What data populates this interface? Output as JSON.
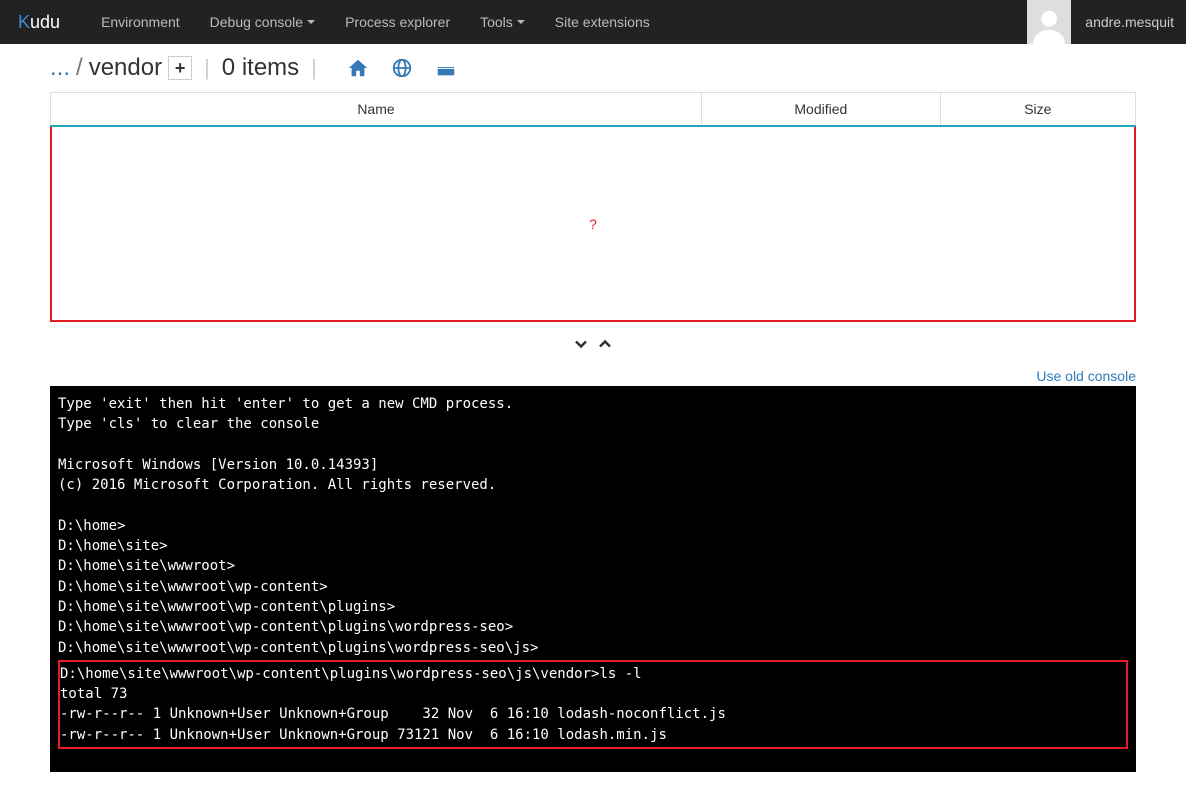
{
  "nav": {
    "brand_prefix": "K",
    "brand_rest": "udu",
    "items": [
      {
        "label": "Environment",
        "dropdown": false
      },
      {
        "label": "Debug console",
        "dropdown": true
      },
      {
        "label": "Process explorer",
        "dropdown": false
      },
      {
        "label": "Tools",
        "dropdown": true
      },
      {
        "label": "Site extensions",
        "dropdown": false
      }
    ],
    "username": "andre.mesquit"
  },
  "breadcrumb": {
    "ellipsis": "...",
    "current": "vendor",
    "item_count_label": "0 items"
  },
  "table": {
    "headers": {
      "name": "Name",
      "modified": "Modified",
      "size": "Size"
    }
  },
  "dropzone": {
    "placeholder": "?"
  },
  "console_link": "Use old console",
  "console": {
    "intro": [
      "Type 'exit' then hit 'enter' to get a new CMD process.",
      "Type 'cls' to clear the console",
      "",
      "Microsoft Windows [Version 10.0.14393]",
      "(c) 2016 Microsoft Corporation. All rights reserved.",
      "",
      "D:\\home>",
      "D:\\home\\site>",
      "D:\\home\\site\\wwwroot>",
      "D:\\home\\site\\wwwroot\\wp-content>",
      "D:\\home\\site\\wwwroot\\wp-content\\plugins>",
      "D:\\home\\site\\wwwroot\\wp-content\\plugins\\wordpress-seo>",
      "D:\\home\\site\\wwwroot\\wp-content\\plugins\\wordpress-seo\\js>"
    ],
    "highlight": [
      "D:\\home\\site\\wwwroot\\wp-content\\plugins\\wordpress-seo\\js\\vendor>ls -l",
      "total 73",
      "-rw-r--r-- 1 Unknown+User Unknown+Group    32 Nov  6 16:10 lodash-noconflict.js",
      "-rw-r--r-- 1 Unknown+User Unknown+Group 73121 Nov  6 16:10 lodash.min.js"
    ],
    "prompt": "D:\\home\\site\\wwwroot\\wp-content\\plugins\\wordpress-seo\\js\\vendor>"
  }
}
